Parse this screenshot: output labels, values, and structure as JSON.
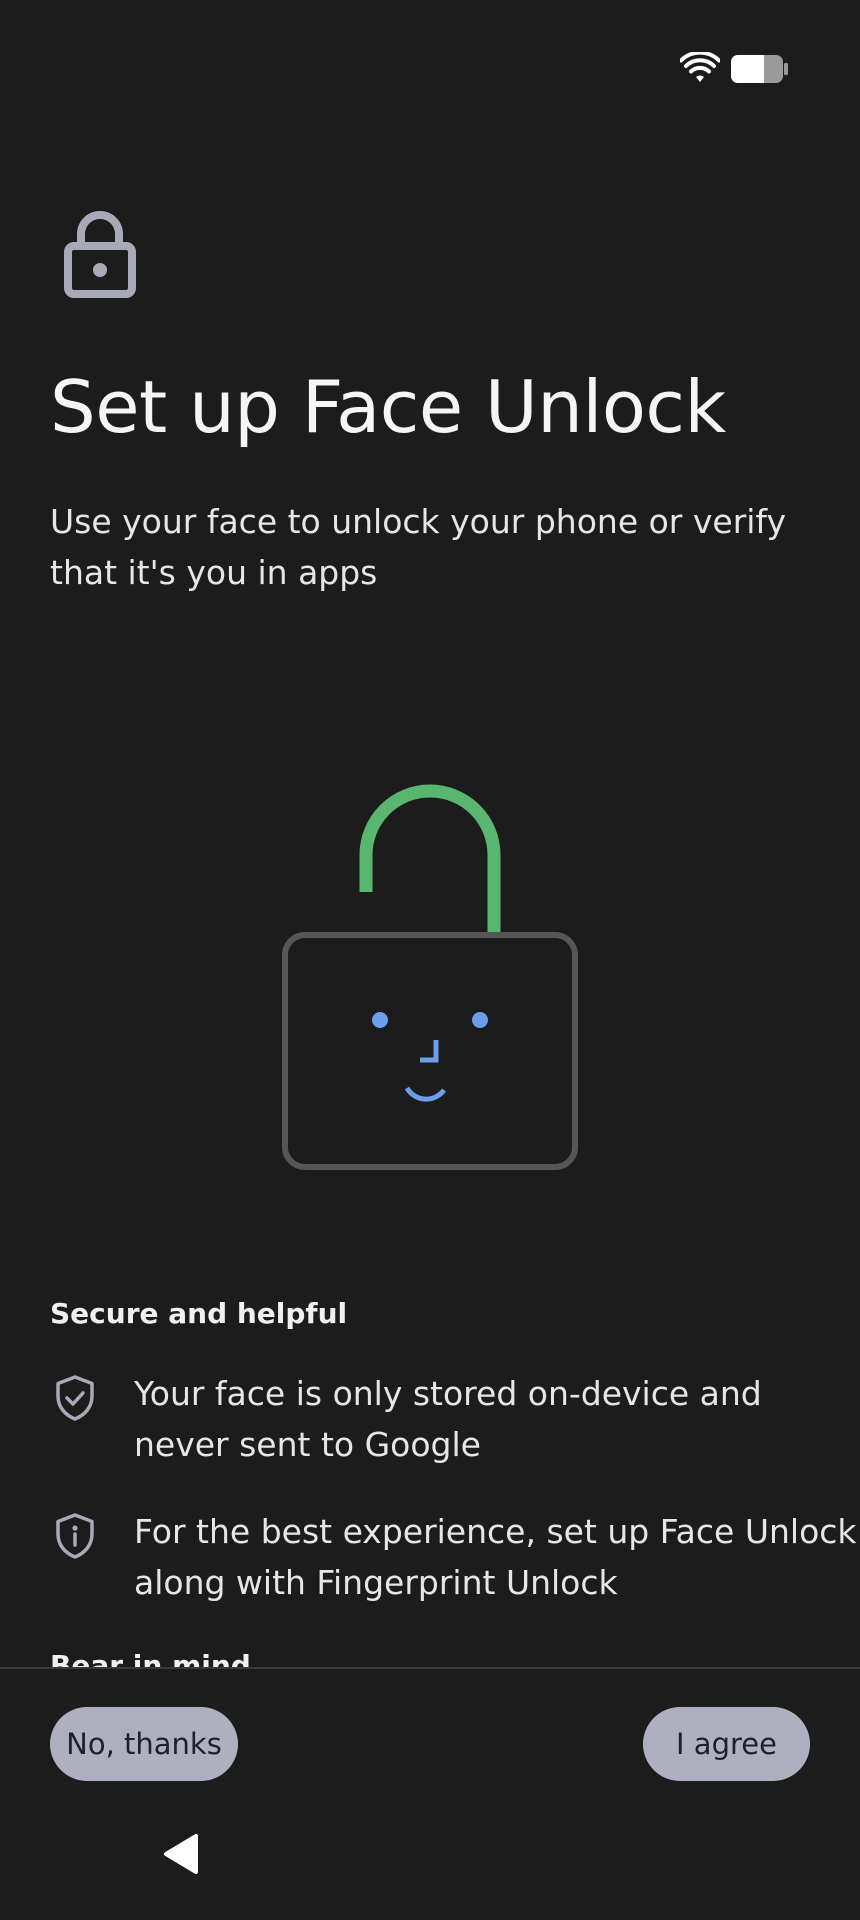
{
  "status_bar": {
    "icons": [
      "wifi-icon",
      "battery-icon"
    ]
  },
  "header": {
    "icon": "lock-icon",
    "title": "Set up Face Unlock",
    "description": "Use your face to unlock your phone or verify that it's you in apps"
  },
  "illustration": {
    "name": "face-unlock-padlock-illustration",
    "colors": {
      "shackle": "#58b66f",
      "body_outline": "#565656",
      "face": "#6d9eeb"
    }
  },
  "sections": {
    "secure_heading": "Secure and helpful",
    "items": [
      {
        "icon": "shield-check-icon",
        "text": "Your face is only stored on-device and never sent to Google"
      },
      {
        "icon": "shield-info-icon",
        "text": "For the best experience, set up Face Unlock along with Fingerprint Unlock"
      }
    ],
    "bear_heading": "Bear in mind"
  },
  "footer": {
    "no_thanks_label": "No, thanks",
    "agree_label": "I agree"
  },
  "nav": {
    "back_icon": "back-triangle-icon"
  },
  "colors": {
    "background": "#1c1c1c",
    "button_bg": "#aeb0c0",
    "button_text": "#1f1f2e",
    "icon_gray": "#a9aab7"
  }
}
